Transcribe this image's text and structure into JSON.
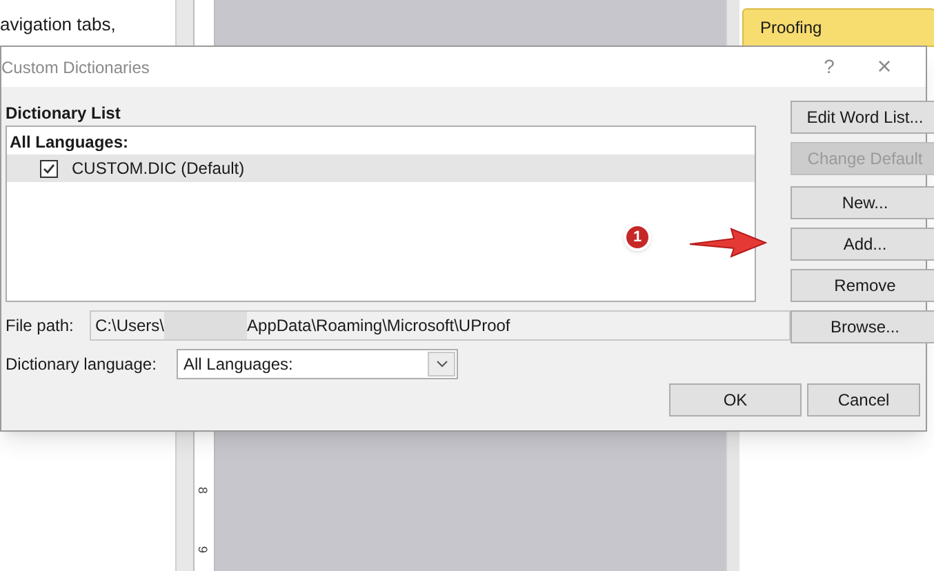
{
  "background": {
    "left_pane_text": "avigation tabs,",
    "ribbon_tab": "Proofing",
    "ruler_labels": [
      "8",
      "9"
    ]
  },
  "dialog": {
    "title": "Custom Dictionaries",
    "help": "?",
    "close": "×",
    "list_label": "Dictionary List",
    "list": {
      "group": "All Languages:",
      "items": [
        {
          "label": "CUSTOM.DIC (Default)",
          "checked": true,
          "selected": true
        }
      ]
    },
    "side_buttons": [
      {
        "label": "Edit Word List...",
        "disabled": false
      },
      {
        "label": "Change Default",
        "disabled": true
      },
      {
        "label": "New...",
        "disabled": false
      },
      {
        "label": "Add...",
        "disabled": false
      },
      {
        "label": "Remove",
        "disabled": false
      }
    ],
    "file_path": {
      "label": "File path:",
      "value_start": "C:\\Users\\",
      "value_end": "AppData\\Roaming\\Microsoft\\UProof",
      "browse": "Browse..."
    },
    "language": {
      "label": "Dictionary language:",
      "value": "All Languages:"
    },
    "buttons": [
      "OK",
      "Cancel"
    ],
    "callout": {
      "number": "1"
    }
  }
}
